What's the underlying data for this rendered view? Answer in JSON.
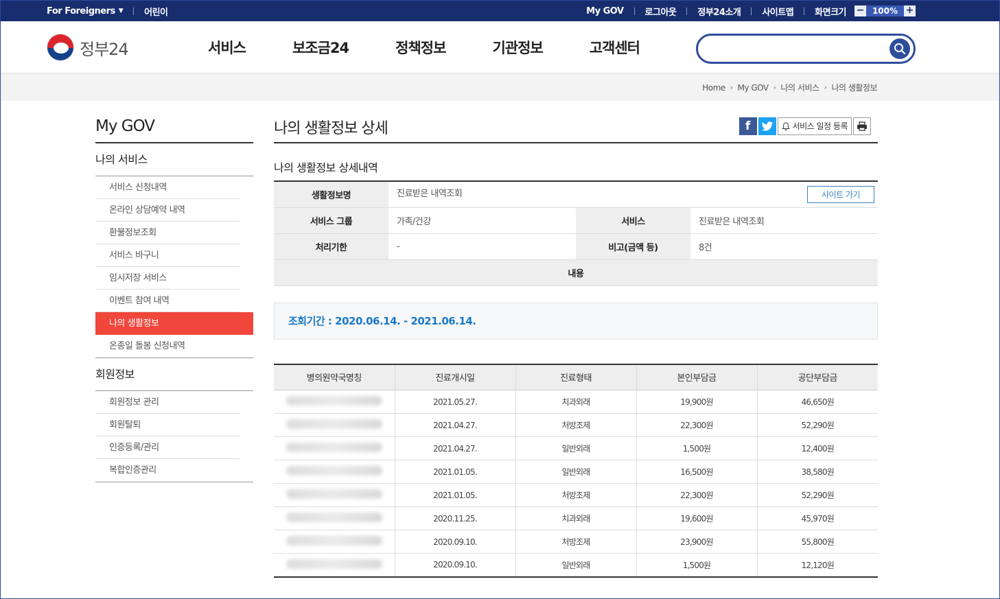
{
  "topbar": {
    "foreigners": "For Foreigners",
    "kids": "어린이",
    "links": [
      "My GOV",
      "로그아웃",
      "정부24소개",
      "사이트맵"
    ],
    "zoom_label": "화면크기",
    "zoom_minus": "−",
    "zoom_value": "100%",
    "zoom_plus": "+"
  },
  "header": {
    "logo_text": "정부24",
    "menu": [
      "서비스",
      "보조금24",
      "정책정보",
      "기관정보",
      "고객센터"
    ],
    "search_placeholder": ""
  },
  "breadcrumb": [
    "Home",
    "My GOV",
    "나의 서비스",
    "나의 생활정보"
  ],
  "sidebar": {
    "title": "My GOV",
    "group1": "나의 서비스",
    "items1": [
      "서비스 신청내역",
      "온라인 상담예약 내역",
      "환불정보조회",
      "서비스 바구니",
      "임시저장 서비스",
      "이벤트 참여 내역",
      "나의 생활정보",
      "온종일 돌봄 신청내역"
    ],
    "group2": "회원정보",
    "items2": [
      "회원정보 관리",
      "회원탈퇴",
      "인증등록/관리",
      "복합인증관리"
    ]
  },
  "main": {
    "title": "나의 생활정보 상세",
    "schedule_button": "서비스 일정 등록",
    "subtitle": "나의 생활정보 상세내역",
    "info": {
      "name_label": "생활정보명",
      "name_value": "진료받은 내역조회",
      "site_button": "사이트 가기",
      "group_label": "서비스 그룹",
      "group_value": "가족/건강",
      "service_label": "서비스",
      "service_value": "진료받은 내역조회",
      "deadline_label": "처리기한",
      "deadline_value": "-",
      "note_label": "비고(금액 등)",
      "note_value": "8건",
      "content_label": "내용"
    },
    "period": "조회기간 : 2020.06.14. - 2021.06.14.",
    "list": {
      "headers": [
        "병의원약국명칭",
        "진료개시일",
        "진료형태",
        "본인부담금",
        "공단부담금"
      ],
      "rows": [
        [
          "",
          "2021.05.27.",
          "치과외래",
          "19,900원",
          "46,650원"
        ],
        [
          "",
          "2021.04.27.",
          "처방조제",
          "22,300원",
          "52,290원"
        ],
        [
          "",
          "2021.04.27.",
          "일반외래",
          "1,500원",
          "12,400원"
        ],
        [
          "",
          "2021.01.05.",
          "일반외래",
          "16,500원",
          "38,580원"
        ],
        [
          "",
          "2021.01.05.",
          "처방조제",
          "22,300원",
          "52,290원"
        ],
        [
          "",
          "2020.11.25.",
          "치과외래",
          "19,600원",
          "45,970원"
        ],
        [
          "",
          "2020.09.10.",
          "처방조제",
          "23,900원",
          "55,800원"
        ],
        [
          "",
          "2020.09.10.",
          "일반외래",
          "1,500원",
          "12,120원"
        ]
      ]
    }
  }
}
